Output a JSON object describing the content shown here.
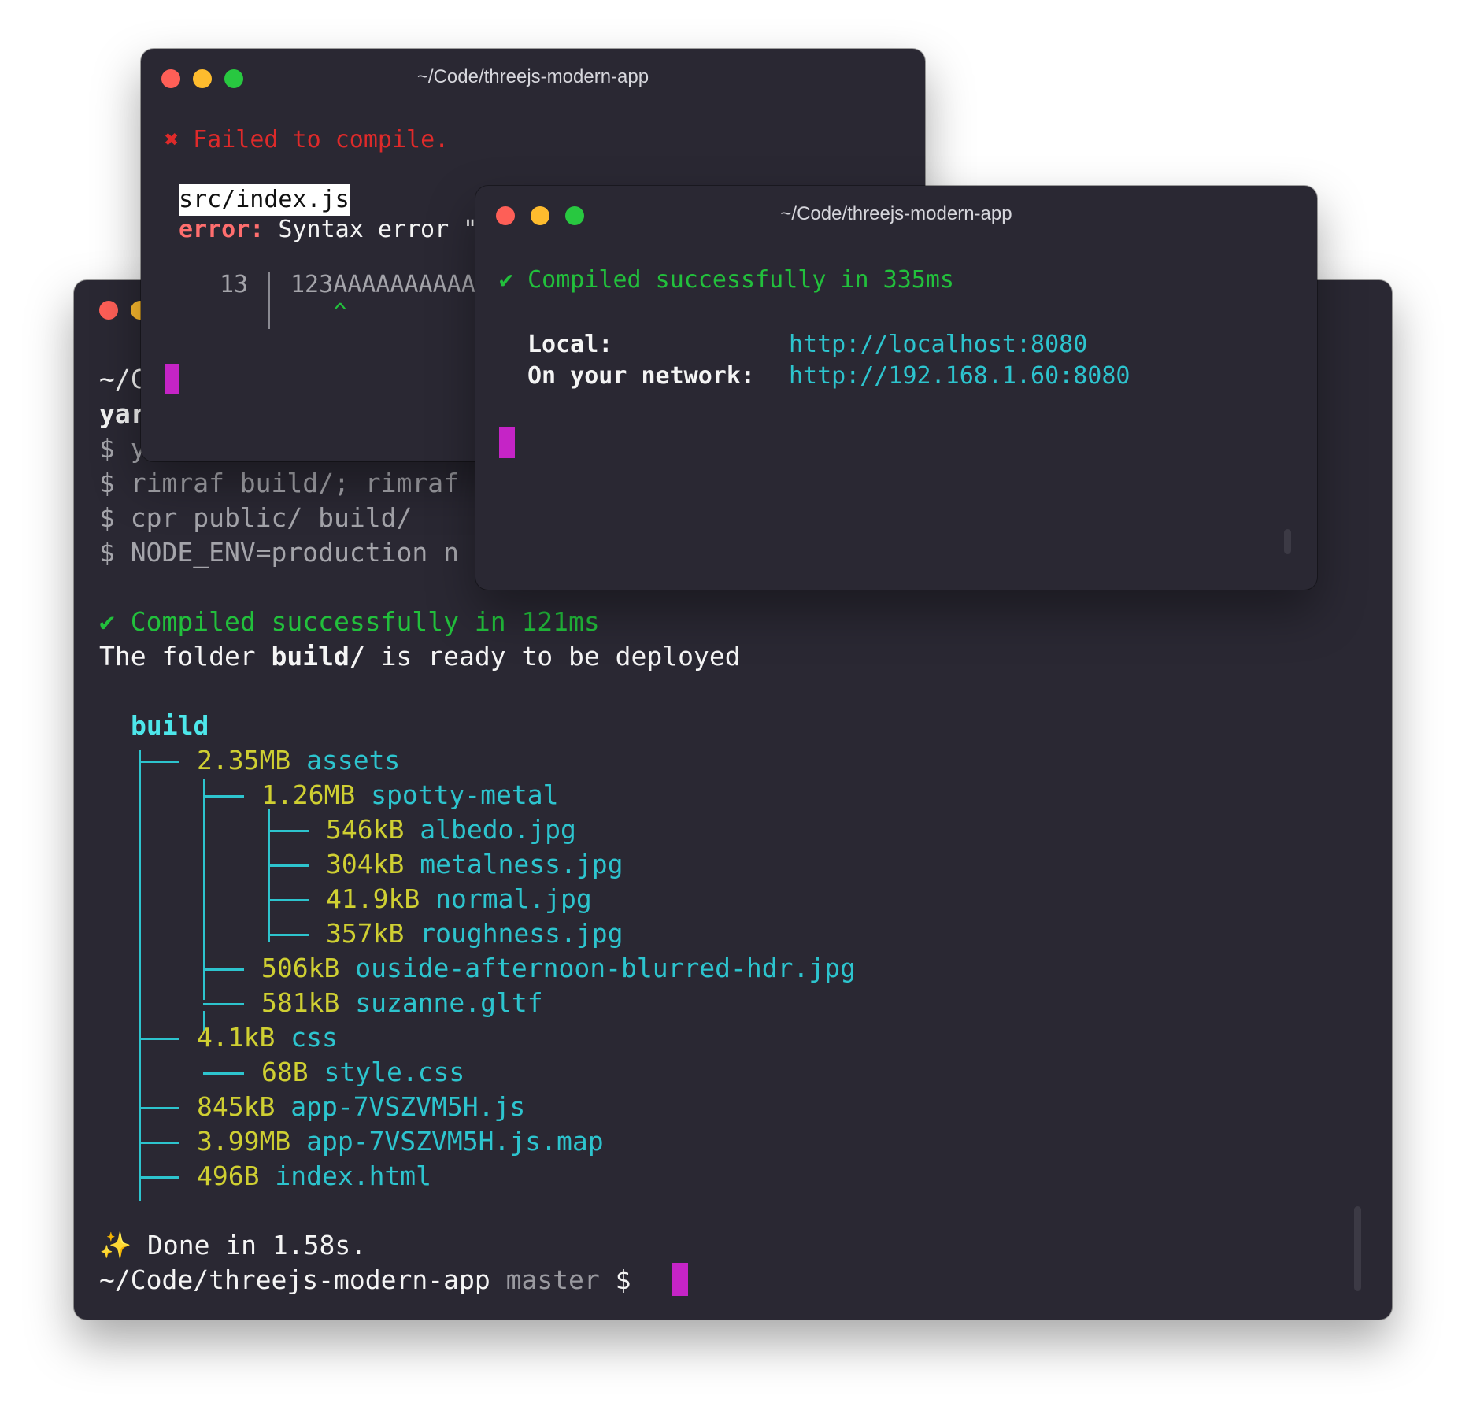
{
  "main_terminal": {
    "partial_prompt": "~/C",
    "partial_cmd": "yar",
    "cmd_lines": [
      "$ y",
      "$ rimraf build/; rimraf",
      "$ cpr public/ build/",
      "$ NODE_ENV=production n"
    ],
    "compiled": {
      "check": "✔",
      "text": "Compiled successfully in 121ms"
    },
    "ready": {
      "before": "The folder ",
      "folder": "build/",
      "after": " is ready to be deployed"
    },
    "tree_root": "build",
    "tree": [
      {
        "size": "2.35MB",
        "name": "assets"
      },
      {
        "size": "1.26MB",
        "name": "spotty-metal"
      },
      {
        "size": "546kB",
        "name": "albedo.jpg"
      },
      {
        "size": "304kB",
        "name": "metalness.jpg"
      },
      {
        "size": "41.9kB",
        "name": "normal.jpg"
      },
      {
        "size": "357kB",
        "name": "roughness.jpg"
      },
      {
        "size": "506kB",
        "name": "ouside-afternoon-blurred-hdr.jpg"
      },
      {
        "size": "581kB",
        "name": "suzanne.gltf"
      },
      {
        "size": "4.1kB",
        "name": "css"
      },
      {
        "size": "68B",
        "name": "style.css"
      },
      {
        "size": "845kB",
        "name": "app-7VSZVM5H.js"
      },
      {
        "size": "3.99MB",
        "name": "app-7VSZVM5H.js.map"
      },
      {
        "size": "496B",
        "name": "index.html"
      }
    ],
    "done": {
      "icon": "✨",
      "text": "Done in 1.58s."
    },
    "prompt": {
      "path": "~/Code/threejs-modern-app",
      "branch": "master",
      "symbol": "$"
    }
  },
  "error_terminal": {
    "title": "~/Code/threejs-modern-app",
    "failed": {
      "icon": "✖",
      "text": "Failed to compile."
    },
    "file": "src/index.js",
    "error_label": "error:",
    "error_text": " Syntax error \"",
    "line_number": "13",
    "code": "123AAAAAAAAAAA",
    "caret": "^"
  },
  "dev_terminal": {
    "title": "~/Code/threejs-modern-app",
    "compiled": {
      "check": "✔",
      "text": "Compiled successfully in 335ms"
    },
    "local": {
      "label": "Local:",
      "url": "http://localhost:8080"
    },
    "network": {
      "label": "On your network:",
      "url": "http://192.168.1.60:8080"
    }
  },
  "colors": {
    "background": "#2a2833",
    "cursor": "#c524c6",
    "success": "#22c03c",
    "link": "#2dc4ce",
    "size": "#cfcf32",
    "error": "#de2a2a"
  }
}
